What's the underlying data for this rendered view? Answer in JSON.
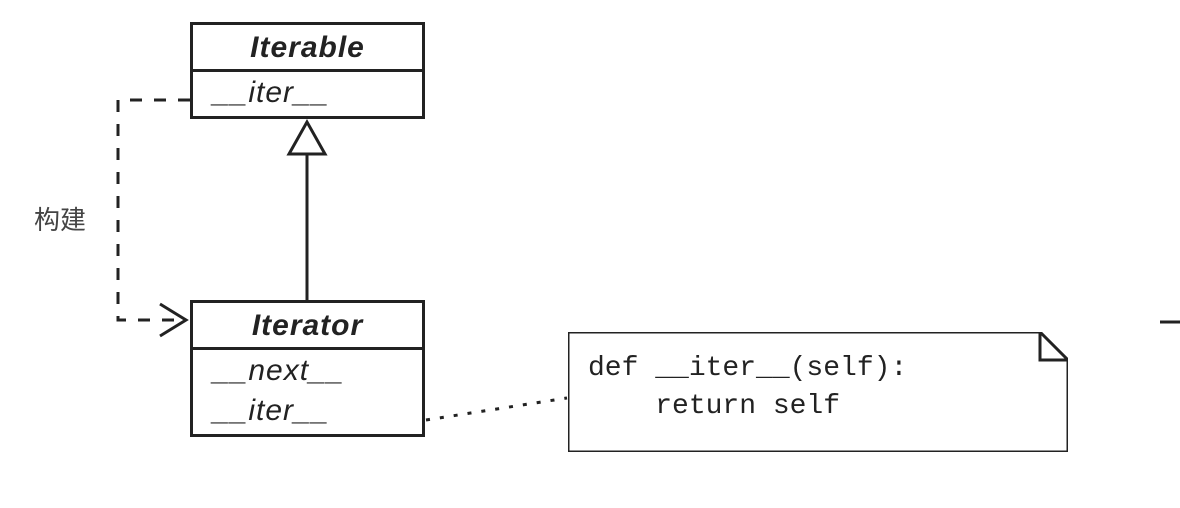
{
  "diagram": {
    "iterable": {
      "title": "Iterable",
      "members": [
        "__iter__"
      ]
    },
    "iterator": {
      "title": "Iterator",
      "members": [
        "__next__",
        "__iter__"
      ]
    },
    "note": {
      "line1": "def __iter__(self):",
      "line2": "    return self"
    },
    "dependency_label": "构建"
  }
}
